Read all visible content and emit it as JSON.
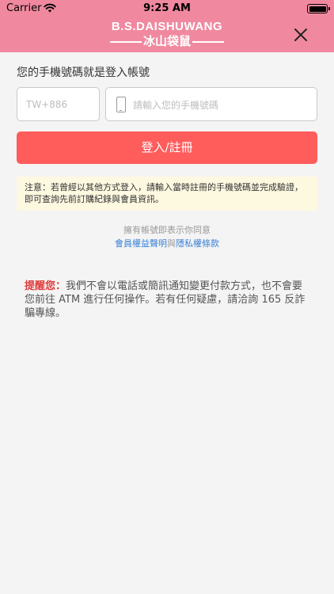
{
  "status_bar": {
    "carrier": "Carrier",
    "time": "9:25 AM"
  },
  "header": {
    "logo_top": "B.S.DAISHUWANG",
    "logo_bottom": "冰山袋鼠",
    "background_color": "#f0899f"
  },
  "login": {
    "prompt": "您的手機號碼就是登入帳號",
    "country_code_placeholder": "TW+886",
    "phone_placeholder": "請輸入您的手機號碼",
    "submit_label": "登入/註冊",
    "submit_color": "#ff5c5c"
  },
  "notice": {
    "text": "注意：若曾經以其他方式登入，請輸入當時註冊的手機號碼並完成驗證，即可查詢先前訂購紀錄與會員資訊。"
  },
  "agreement": {
    "text": "擁有帳號即表示你同意",
    "link_terms": "會員權益聲明",
    "conjunction": "與",
    "link_privacy": "隱私權條款"
  },
  "reminder": {
    "label": "提醒您：",
    "text": "我們不會以電話或簡訊通知變更付款方式，也不會要您前往 ATM 進行任何操作。若有任何疑慮，請洽詢 165 反詐騙專線。"
  }
}
